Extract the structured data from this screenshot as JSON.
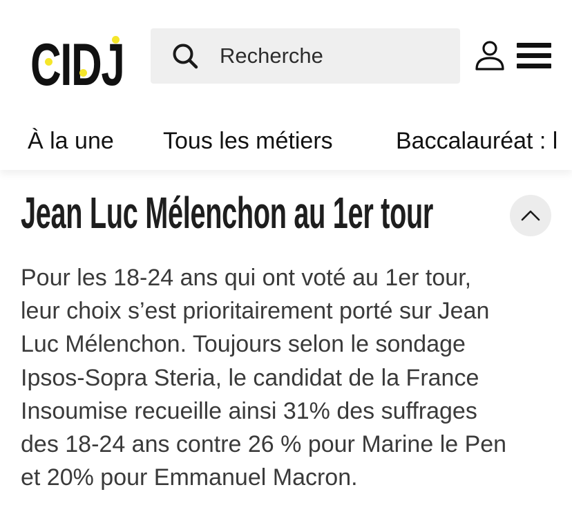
{
  "header": {
    "logo_text": "CIDJ",
    "logo_accent_color": "#f5e62a",
    "search": {
      "placeholder": "Recherche",
      "icon": "search-icon"
    },
    "user_icon": "user-icon",
    "menu_icon": "hamburger-menu-icon"
  },
  "nav": {
    "items": [
      {
        "label": "À la une"
      },
      {
        "label": "Tous les métiers"
      },
      {
        "label": "Baccalauréat : l"
      }
    ]
  },
  "article": {
    "title": "Jean Luc Mélenchon au 1er tour",
    "collapse_icon": "chevron-up-icon",
    "paragraph_lines": [
      "Pour les 18-24 ans qui ont voté au 1er tour,",
      "leur choix s’est prioritairement porté sur Jean",
      "Luc Mélenchon. Toujours selon le sondage",
      "Ipsos-Sopra Steria, le candidat de la France",
      "Insoumise recueille ainsi 31% des suffrages",
      "des 18-24 ans contre 26 % pour Marine le Pen",
      "et 20% pour Emmanuel Macron."
    ]
  }
}
